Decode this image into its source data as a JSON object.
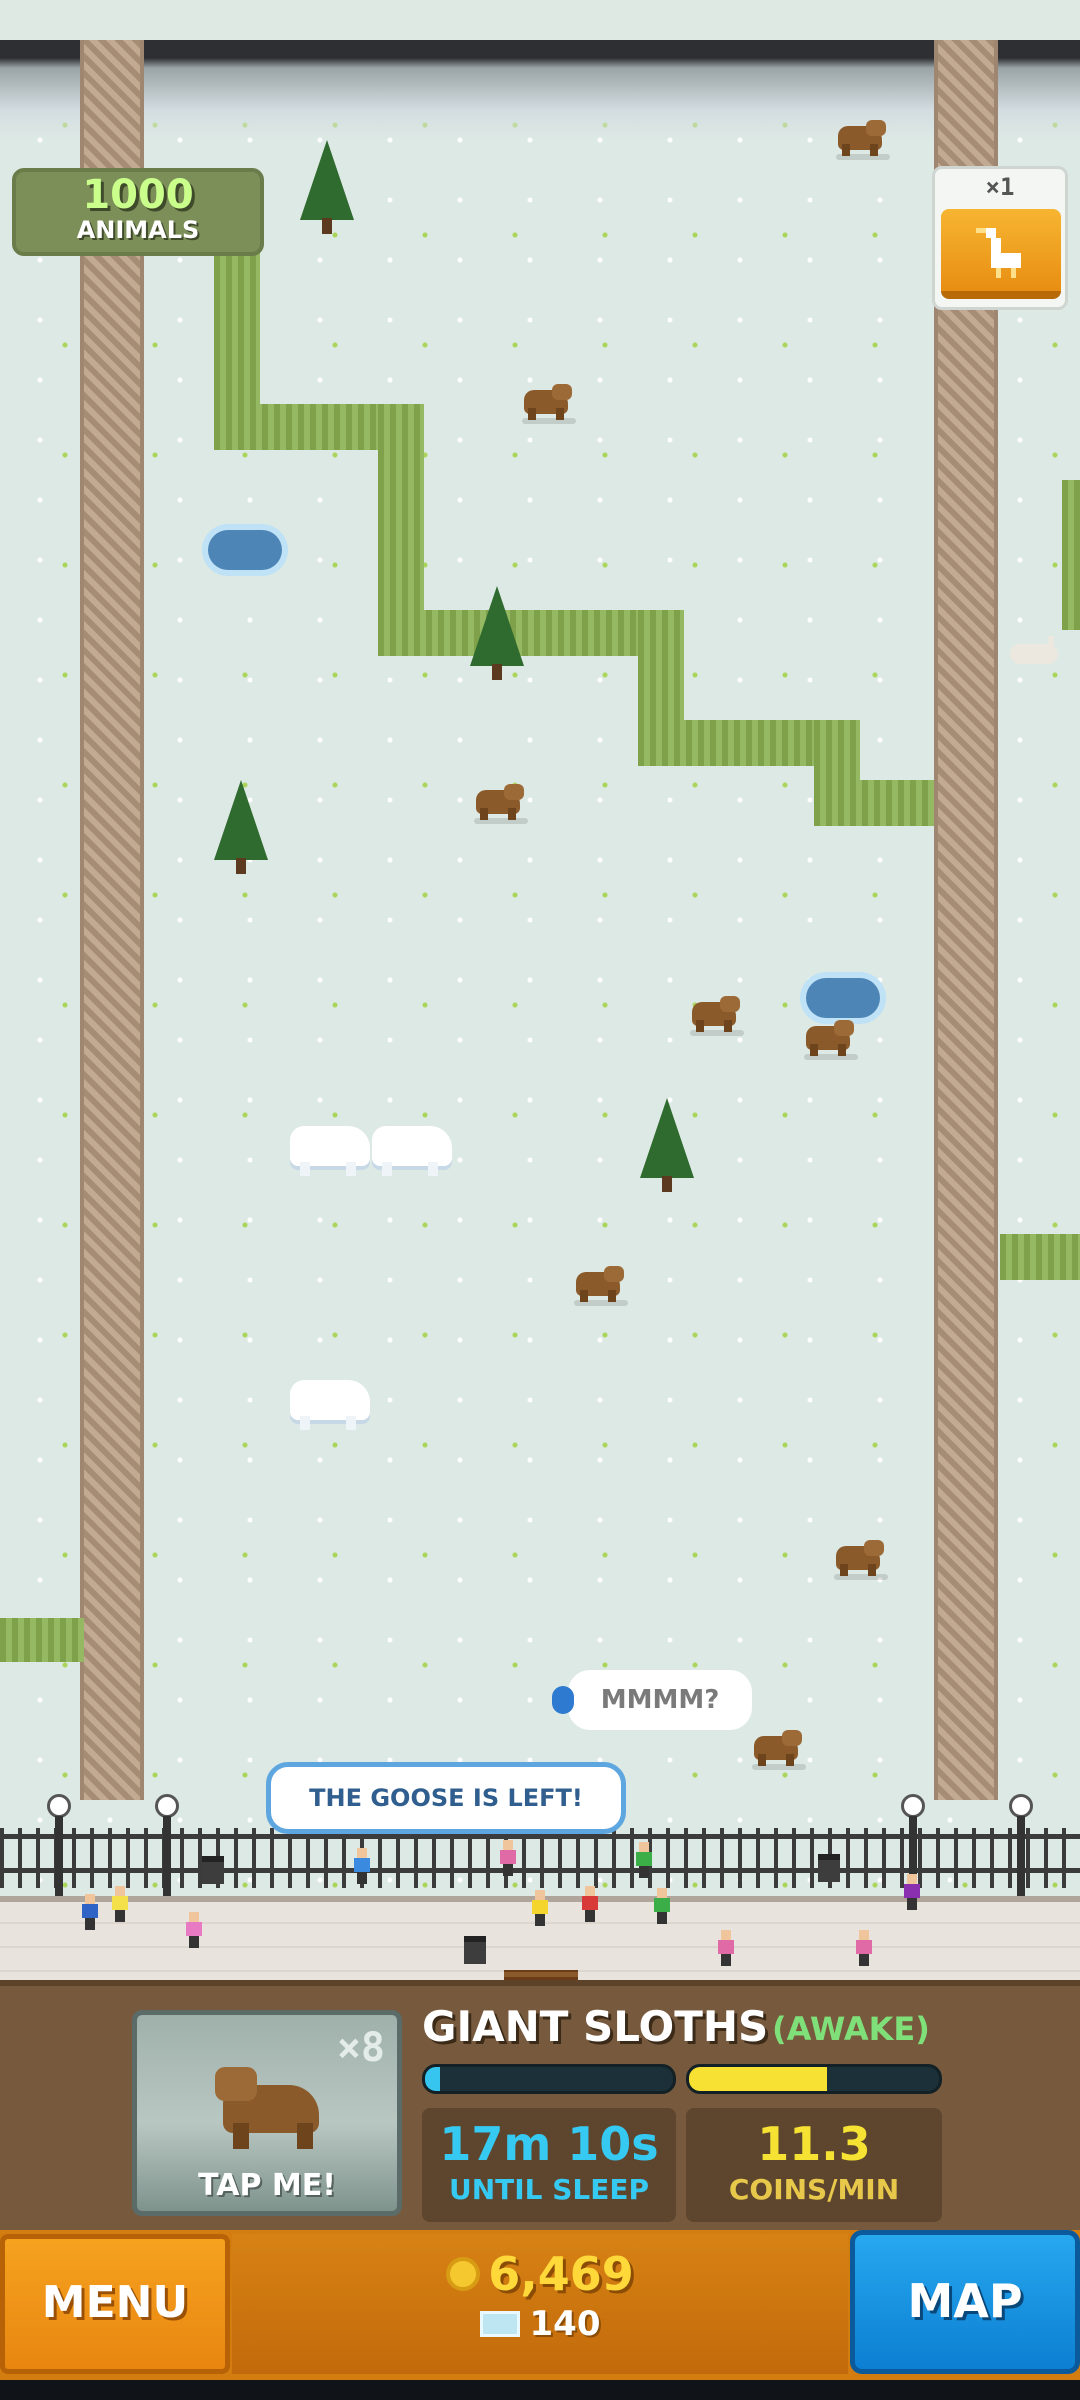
{
  "animal_counter": {
    "count": "1000",
    "label": "ANIMALS"
  },
  "goose_widget": {
    "multiplier": "×1",
    "icon": "goose-icon"
  },
  "speech": {
    "animal": "MMMM?",
    "goose": "THE GOOSE IS LEFT!"
  },
  "enclosure": {
    "tap_card": {
      "multiplier": "×8",
      "tap_label": "TAP ME!"
    },
    "species": "GIANT SLOTHS",
    "state": "(AWAKE)",
    "sleep_bar_fill": 0.06,
    "coin_bar_fill": 0.55,
    "sleep_time": "17m 10s",
    "sleep_label": "UNTIL SLEEP",
    "coin_rate": "11.3",
    "coin_label": "COINS/MIN"
  },
  "nav": {
    "menu_label": "MENU",
    "map_label": "MAP",
    "coins": "6,469",
    "tickets": "140"
  },
  "colors": {
    "accent_orange": "#e88610",
    "accent_blue": "#0c7fd2",
    "coin_yellow": "#ffd93a",
    "awake_green": "#7fe07a"
  }
}
